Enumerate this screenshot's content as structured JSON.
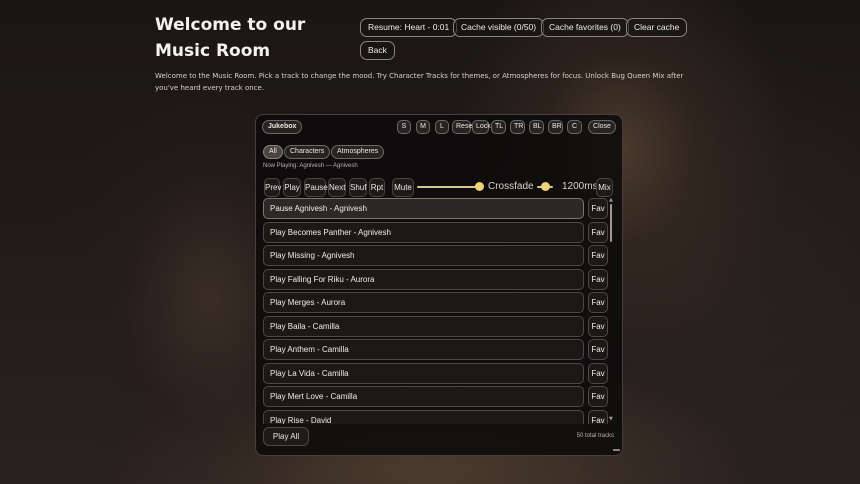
{
  "page": {
    "title": "Welcome to our Music Room",
    "intro": "Welcome to the Music Room. Pick a track to change the mood. Try Character Tracks for themes, or Atmospheres for focus. Unlock Bug Queen Mix after you've heard every track once."
  },
  "top_buttons": {
    "resume": "Resume: Heart - 0:01",
    "cache_visible": "Cache visible (0/50)",
    "cache_favorites": "Cache favorites (0)",
    "clear_cache": "Clear cache",
    "back": "Back"
  },
  "jukebox": {
    "title": "Jukebox",
    "size_buttons": [
      "S",
      "M",
      "L",
      "Reset",
      "Lock",
      "TL",
      "TR",
      "BL",
      "BR",
      "C"
    ],
    "close": "Close",
    "filters": [
      "All",
      "Characters",
      "Atmospheres"
    ],
    "active_filter": "All",
    "now_playing": "Now Playing: Agnivesh — Agnivesh",
    "controls": {
      "prev": "Prev",
      "play": "Play",
      "pause": "Pause",
      "next": "Next",
      "shuffle": "Shuf",
      "repeat": "Rpt",
      "mute": "Mute",
      "volume_level": 0.95,
      "crossfade_label": "Crossfade",
      "crossfade_level": 0.5,
      "crossfade_value": "1200ms",
      "mix": "Mix"
    },
    "tracks": [
      {
        "label": "Pause Agnivesh - Agnivesh",
        "fav": "Fav",
        "active": true
      },
      {
        "label": "Play Becomes Panther - Agnivesh",
        "fav": "Fav"
      },
      {
        "label": "Play Missing - Agnivesh",
        "fav": "Fav"
      },
      {
        "label": "Play Falling For Riku - Aurora",
        "fav": "Fav"
      },
      {
        "label": "Play Merges - Aurora",
        "fav": "Fav"
      },
      {
        "label": "Play Baila - Camilla",
        "fav": "Fav"
      },
      {
        "label": "Play Anthem - Camilla",
        "fav": "Fav"
      },
      {
        "label": "Play La Vida - Camilla",
        "fav": "Fav"
      },
      {
        "label": "Play Mert Love - Camilla",
        "fav": "Fav"
      },
      {
        "label": "Play Rise - David",
        "fav": "Fav"
      }
    ],
    "play_all": "Play All",
    "total": "50 total tracks"
  },
  "colors": {
    "accent": "#f0d27a",
    "panel_bg": "#0c0b0b",
    "text": "#f0ece6"
  }
}
